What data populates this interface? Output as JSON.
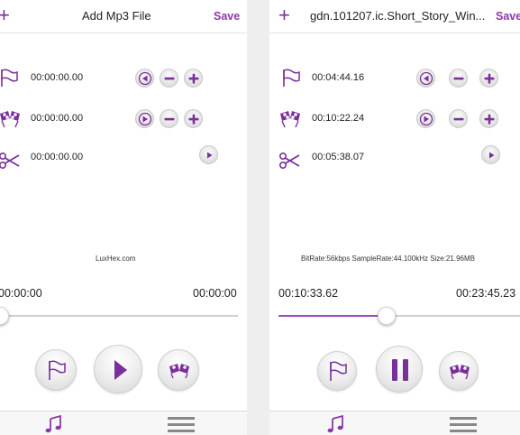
{
  "left": {
    "add_glyph": "+",
    "title": "Add Mp3 File",
    "save_label": "Save",
    "start_time": "00:00:00.00",
    "end_time": "00:00:00.00",
    "cut_time": "00:00:00.00",
    "info": "LuxHex.com",
    "current_time": "00:00:00",
    "total_time": "00:00:00",
    "progress": 0.0,
    "play_state": "play"
  },
  "right": {
    "add_glyph": "+",
    "title": "gdn.101207.ic.Short_Story_Win...",
    "save_label": "Save",
    "start_time": "00:04:44.16",
    "end_time": "00:10:22.24",
    "cut_time": "00:05:38.07",
    "info": "BitRate:56kbps  SampleRate:44.100kHz  Size:21.96MB",
    "current_time": "00:10:33.62",
    "total_time": "00:23:45.23",
    "progress": 0.44,
    "play_state": "pause"
  },
  "icons": {
    "start_flag": "flag-icon",
    "end_flag": "checkered-flags-icon",
    "cut": "scissors-icon",
    "rewind": "rewind-circle-icon",
    "forward": "forward-circle-icon",
    "minus": "minus-circle-icon",
    "plus": "plus-circle-icon",
    "preview": "play-small-icon",
    "music_tab": "music-note-icon",
    "list_tab": "hamburger-menu-icon"
  },
  "colors": {
    "accent": "#8a3aa8",
    "icon_purple": "#7a2f9b",
    "background": "#ffffff"
  }
}
